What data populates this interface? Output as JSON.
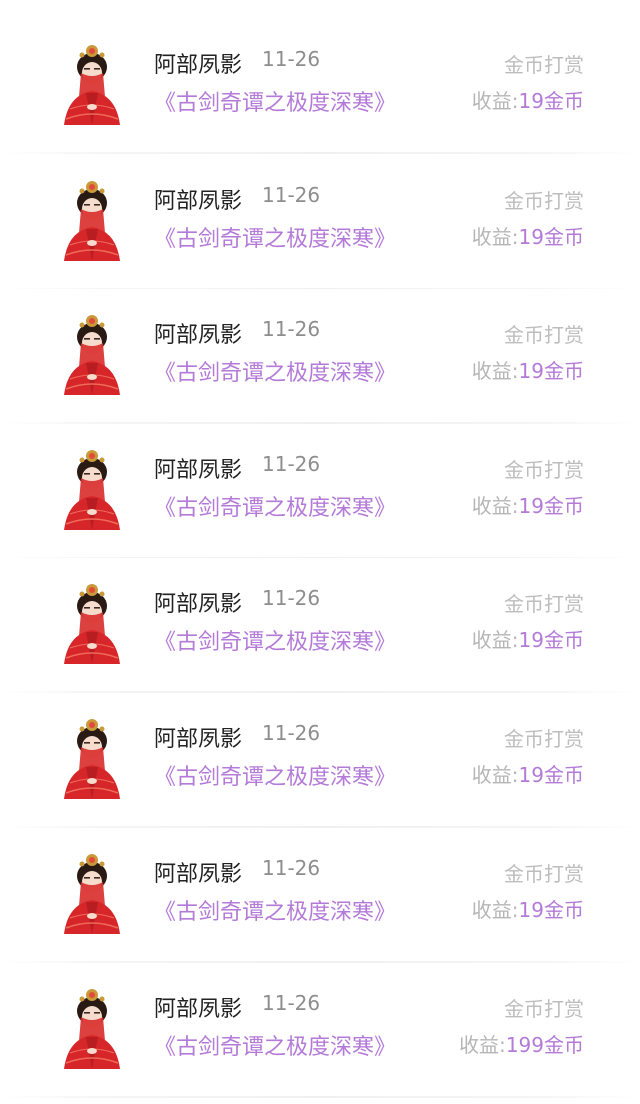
{
  "items": [
    {
      "user": "阿部夙影",
      "date": "11-26",
      "title": "《古剑奇谭之极度深寒》",
      "type": "金币打赏",
      "earn_label": "收益:",
      "earn_value": "19金币"
    },
    {
      "user": "阿部夙影",
      "date": "11-26",
      "title": "《古剑奇谭之极度深寒》",
      "type": "金币打赏",
      "earn_label": "收益:",
      "earn_value": "19金币"
    },
    {
      "user": "阿部夙影",
      "date": "11-26",
      "title": "《古剑奇谭之极度深寒》",
      "type": "金币打赏",
      "earn_label": "收益:",
      "earn_value": "19金币"
    },
    {
      "user": "阿部夙影",
      "date": "11-26",
      "title": "《古剑奇谭之极度深寒》",
      "type": "金币打赏",
      "earn_label": "收益:",
      "earn_value": "19金币"
    },
    {
      "user": "阿部夙影",
      "date": "11-26",
      "title": "《古剑奇谭之极度深寒》",
      "type": "金币打赏",
      "earn_label": "收益:",
      "earn_value": "19金币"
    },
    {
      "user": "阿部夙影",
      "date": "11-26",
      "title": "《古剑奇谭之极度深寒》",
      "type": "金币打赏",
      "earn_label": "收益:",
      "earn_value": "19金币"
    },
    {
      "user": "阿部夙影",
      "date": "11-26",
      "title": "《古剑奇谭之极度深寒》",
      "type": "金币打赏",
      "earn_label": "收益:",
      "earn_value": "19金币"
    },
    {
      "user": "阿部夙影",
      "date": "11-26",
      "title": "《古剑奇谭之极度深寒》",
      "type": "金币打赏",
      "earn_label": "收益:",
      "earn_value": "19金币"
    },
    {
      "user": "阿部夙影",
      "date": "11-26",
      "title": "《古剑奇谭之极度深寒》",
      "type": "金币打赏",
      "earn_label": "收益:",
      "earn_value": "199金币"
    }
  ],
  "colors": {
    "accent": "#b37ad8",
    "avatar_red": "#d7262a",
    "muted": "#bdbdbd"
  },
  "icons": {
    "avatar": "bride-avatar-icon"
  }
}
